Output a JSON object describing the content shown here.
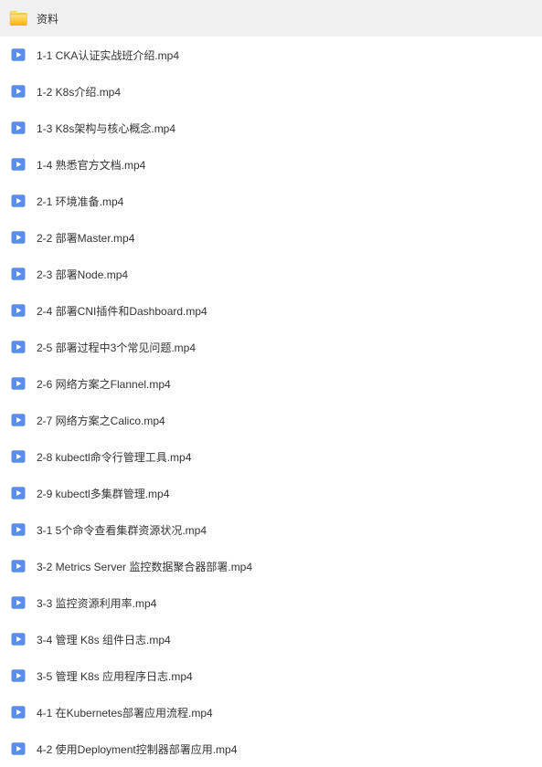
{
  "items": [
    {
      "type": "folder",
      "name": "资料"
    },
    {
      "type": "video",
      "name": "1-1 CKA认证实战班介绍.mp4"
    },
    {
      "type": "video",
      "name": "1-2 K8s介绍.mp4"
    },
    {
      "type": "video",
      "name": "1-3 K8s架构与核心概念.mp4"
    },
    {
      "type": "video",
      "name": "1-4 熟悉官方文档.mp4"
    },
    {
      "type": "video",
      "name": "2-1 环境准备.mp4"
    },
    {
      "type": "video",
      "name": "2-2 部署Master.mp4"
    },
    {
      "type": "video",
      "name": "2-3 部署Node.mp4"
    },
    {
      "type": "video",
      "name": "2-4 部署CNI插件和Dashboard.mp4"
    },
    {
      "type": "video",
      "name": "2-5 部署过程中3个常见问题.mp4"
    },
    {
      "type": "video",
      "name": "2-6 网络方案之Flannel.mp4"
    },
    {
      "type": "video",
      "name": "2-7 网络方案之Calico.mp4"
    },
    {
      "type": "video",
      "name": "2-8 kubectl命令行管理工具.mp4"
    },
    {
      "type": "video",
      "name": "2-9 kubectl多集群管理.mp4"
    },
    {
      "type": "video",
      "name": "3-1 5个命令查看集群资源状况.mp4"
    },
    {
      "type": "video",
      "name": "3-2 Metrics Server 监控数据聚合器部署.mp4"
    },
    {
      "type": "video",
      "name": "3-3 监控资源利用率.mp4"
    },
    {
      "type": "video",
      "name": "3-4 管理 K8s 组件日志.mp4"
    },
    {
      "type": "video",
      "name": "3-5 管理 K8s 应用程序日志.mp4"
    },
    {
      "type": "video",
      "name": "4-1 在Kubernetes部署应用流程.mp4"
    },
    {
      "type": "video",
      "name": "4-2 使用Deployment控制器部署应用.mp4"
    }
  ]
}
